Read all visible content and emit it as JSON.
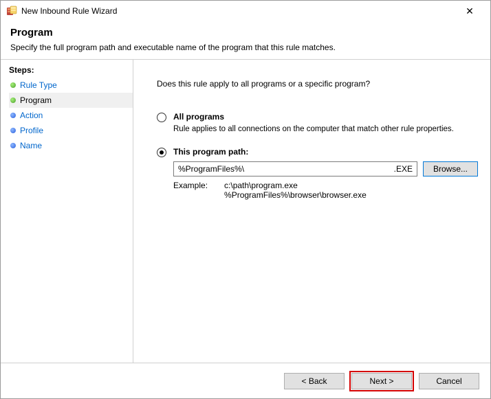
{
  "titlebar": {
    "title": "New Inbound Rule Wizard"
  },
  "header": {
    "heading": "Program",
    "subheading": "Specify the full program path and executable name of the program that this rule matches."
  },
  "sidebar": {
    "title": "Steps:",
    "items": [
      {
        "label": "Rule Type"
      },
      {
        "label": "Program"
      },
      {
        "label": "Action"
      },
      {
        "label": "Profile"
      },
      {
        "label": "Name"
      }
    ]
  },
  "content": {
    "question": "Does this rule apply to all programs or a specific program?",
    "option_all": {
      "label": "All programs",
      "sub": "Rule applies to all connections on the computer that match other rule properties."
    },
    "option_path": {
      "label": "This program path:",
      "value": "%ProgramFiles%\\",
      "ext_tag": ".EXE",
      "browse": "Browse..."
    },
    "example": {
      "label": "Example:",
      "line1": "c:\\path\\program.exe",
      "line2": "%ProgramFiles%\\browser\\browser.exe"
    }
  },
  "footer": {
    "back": "< Back",
    "next": "Next >",
    "cancel": "Cancel"
  }
}
